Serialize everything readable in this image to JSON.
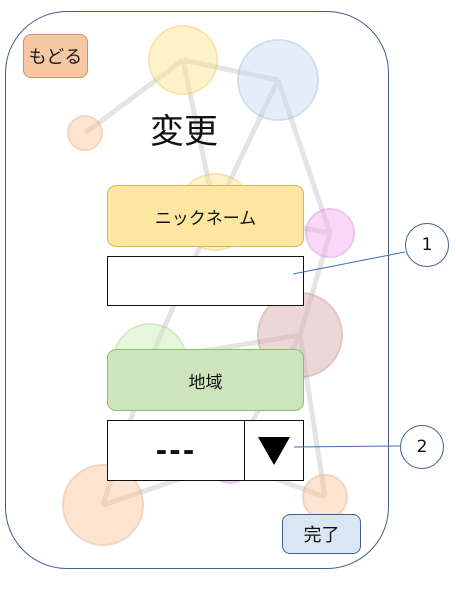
{
  "header": {
    "back_label": "もどる",
    "title": "変更"
  },
  "form": {
    "nickname_label": "ニックネーム",
    "nickname_value": "",
    "region_label": "地域",
    "region_selected": "---"
  },
  "footer": {
    "complete_label": "完了"
  },
  "annotations": {
    "callout_1": "1",
    "callout_2": "2"
  },
  "icons": {
    "dropdown": "triangle-down-icon"
  },
  "colors": {
    "back_button": "#f7c6a3",
    "nickname_label_bg": "#fce6a0",
    "region_label_bg": "#cde4bd",
    "complete_button": "#dbe6f4",
    "frame_border": "#3f5f8f"
  }
}
